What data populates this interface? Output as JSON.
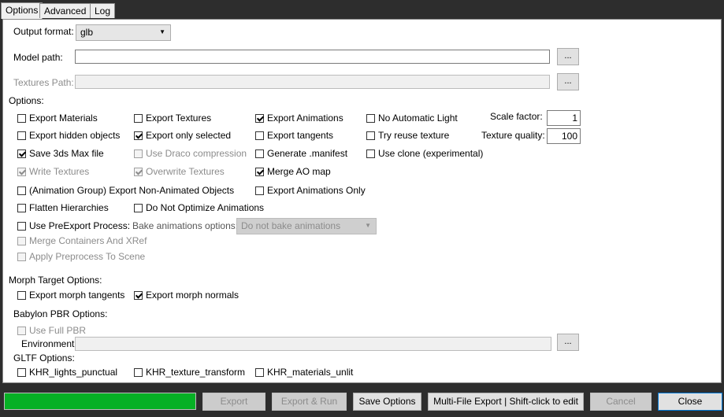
{
  "tabs": [
    "Options",
    "Advanced",
    "Log"
  ],
  "output_format": {
    "label": "Output format:",
    "value": "glb"
  },
  "model_path": {
    "label": "Model path:",
    "value": "",
    "browse": "..."
  },
  "textures_path": {
    "label": "Textures Path:",
    "value": "",
    "browse": "..."
  },
  "options_header": "Options:",
  "checkboxes": {
    "export_materials": "Export Materials",
    "export_textures": "Export Textures",
    "export_animations": "Export Animations",
    "no_auto_light": "No Automatic Light",
    "export_hidden": "Export hidden objects",
    "export_selected": "Export only selected",
    "export_tangents": "Export tangents",
    "try_reuse_texture": "Try reuse texture",
    "save_3ds": "Save 3ds Max file",
    "use_draco": "Use Draco compression",
    "generate_manifest": "Generate .manifest",
    "use_clone": "Use clone (experimental)",
    "write_textures": "Write Textures",
    "overwrite_textures": "Overwrite Textures",
    "merge_ao": "Merge AO map",
    "anim_group_non_animated": "(Animation Group) Export Non-Animated Objects",
    "export_animations_only": "Export Animations Only",
    "flatten_hierarchies": "Flatten Hierarchies",
    "do_not_optimize": "Do Not Optimize Animations",
    "use_preexport": "Use PreExport Process:",
    "merge_containers": "Merge Containers And XRef",
    "apply_preprocess": "Apply Preprocess To Scene",
    "export_morph_tangents": "Export morph tangents",
    "export_morph_normals": "Export morph normals",
    "use_full_pbr": "Use Full PBR",
    "khr_lights": "KHR_lights_punctual",
    "khr_texture_transform": "KHR_texture_transform",
    "khr_materials_unlit": "KHR_materials_unlit"
  },
  "scale_factor": {
    "label": "Scale factor:",
    "value": "1"
  },
  "texture_quality": {
    "label": "Texture quality:",
    "value": "100"
  },
  "bake_animations": {
    "label": "Bake animations options:",
    "value": "Do not bake animations"
  },
  "morph_header": "Morph Target Options:",
  "pbr_header": "Babylon PBR Options:",
  "environment": {
    "label": "Environment",
    "value": "",
    "browse": "..."
  },
  "gltf_header": "GLTF Options:",
  "footer": {
    "progress": 1.0,
    "export": "Export",
    "export_run": "Export & Run",
    "save_options": "Save Options",
    "multi_file": "Multi-File Export | Shift-click to edit",
    "cancel": "Cancel",
    "close": "Close"
  },
  "colors": {
    "progress_fill": "#06b025",
    "focus_border": "#0078d7"
  }
}
